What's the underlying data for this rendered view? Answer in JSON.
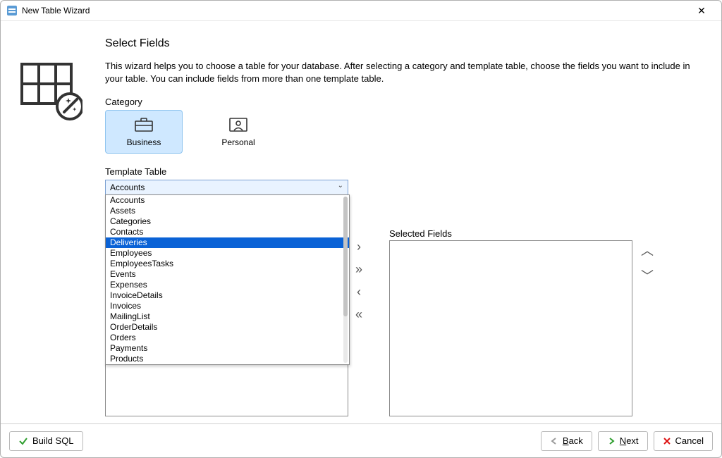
{
  "window": {
    "title": "New Table Wizard"
  },
  "page": {
    "heading": "Select Fields",
    "description": "This wizard helps you to choose a table for your database. After selecting a category and template table, choose the fields you want to include in your table. You can include fields from more than one template table."
  },
  "category": {
    "label": "Category",
    "options": [
      {
        "id": "business",
        "label": "Business",
        "selected": true
      },
      {
        "id": "personal",
        "label": "Personal",
        "selected": false
      }
    ]
  },
  "template_table": {
    "label": "Template Table",
    "value": "Accounts",
    "options": [
      "Accounts",
      "Assets",
      "Categories",
      "Contacts",
      "Deliveries",
      "Employees",
      "EmployeesTasks",
      "Events",
      "Expenses",
      "InvoiceDetails",
      "Invoices",
      "MailingList",
      "OrderDetails",
      "Orders",
      "Payments",
      "Products"
    ],
    "highlighted": "Deliveries"
  },
  "selected_fields": {
    "label": "Selected Fields"
  },
  "footer": {
    "build_sql": "Build SQL",
    "back": "Back",
    "next": "Next",
    "cancel": "Cancel"
  }
}
